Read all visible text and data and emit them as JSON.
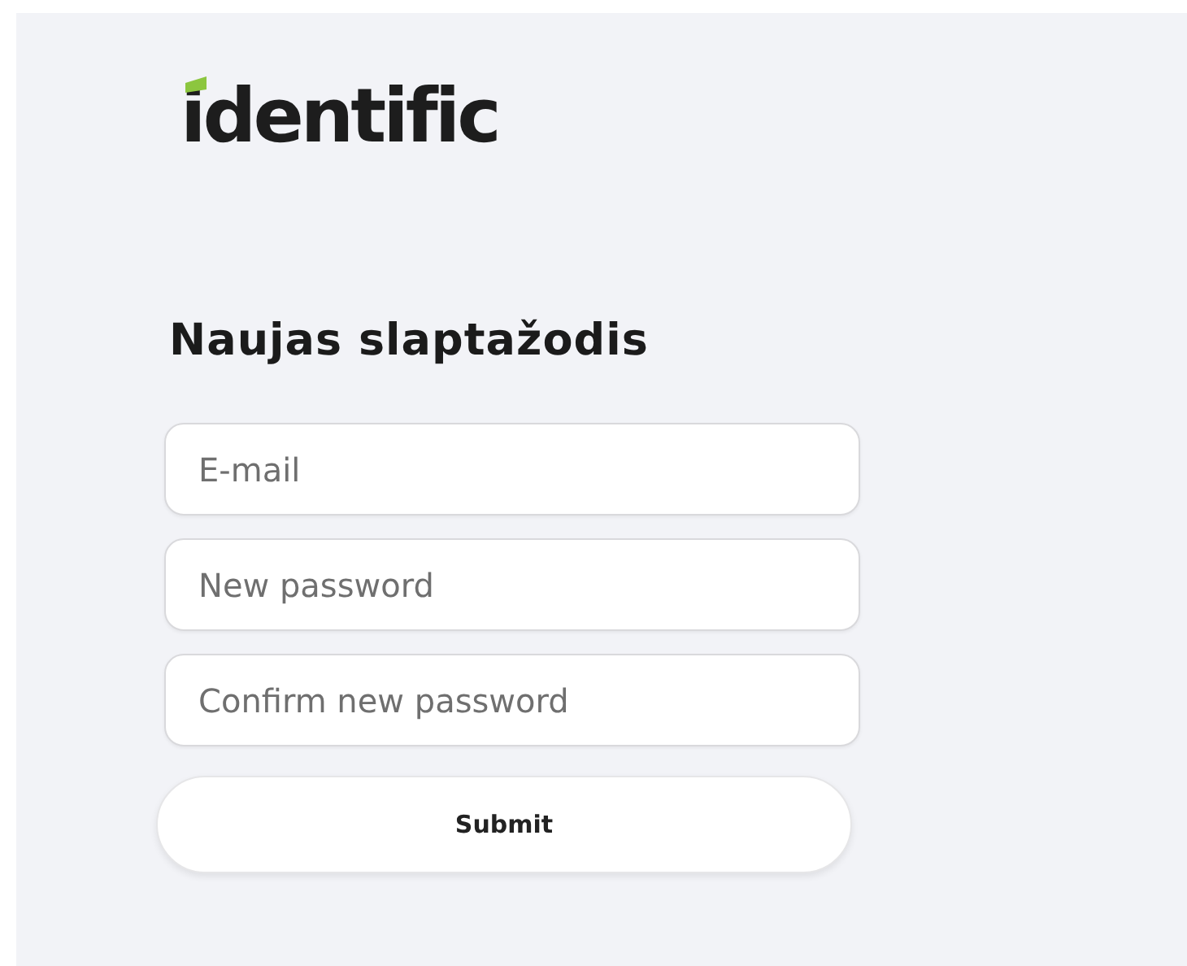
{
  "logo": {
    "text": "identific"
  },
  "heading": "Naujas slaptažodis",
  "fields": [
    {
      "placeholder": "E-mail"
    },
    {
      "placeholder": "New password"
    },
    {
      "placeholder": "Confirm new password"
    }
  ],
  "submit_button": {
    "label": "Submit"
  }
}
